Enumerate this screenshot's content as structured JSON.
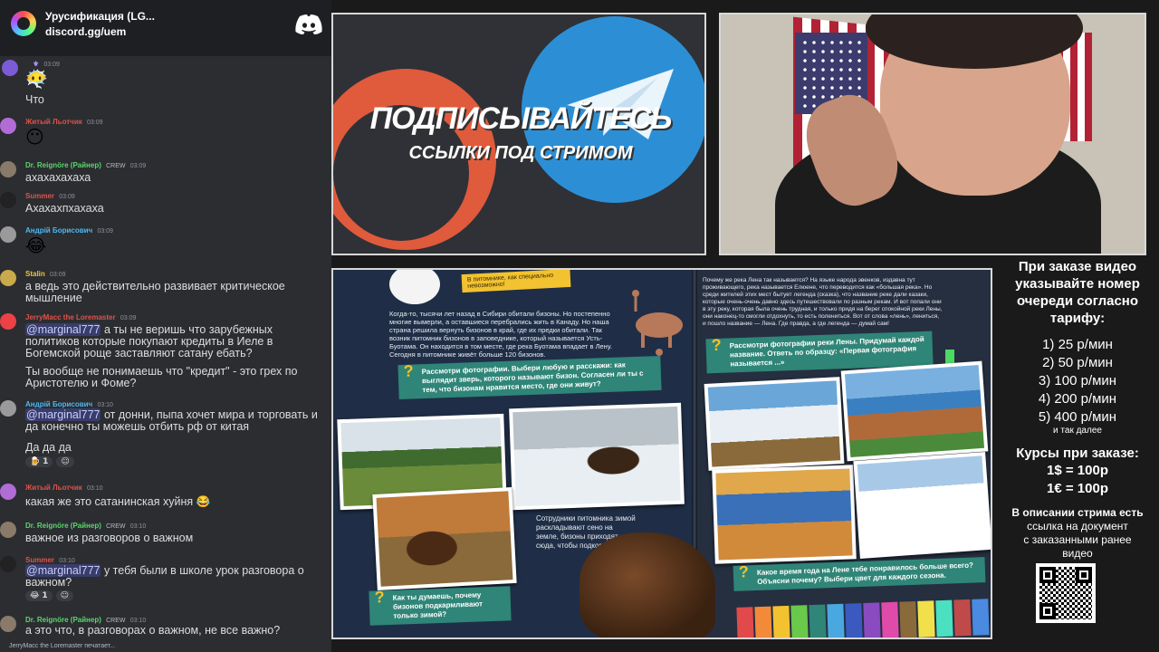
{
  "chat": {
    "server_name": "Урусификация (LG...",
    "server_link": "discord.gg/uem",
    "messages": [
      {
        "user": "",
        "time": "03:09",
        "emoji": "😶‍🌫️",
        "text": "Что",
        "color": "#c9c9c9"
      },
      {
        "user": "Житый Льотчик",
        "time": "03:09",
        "emoji": "😶",
        "text": "",
        "color": "#e0524a"
      },
      {
        "user": "Dr. Reignöre (Райнер)",
        "badge": "CREW",
        "time": "03:09",
        "text": "ахахахахаха",
        "color": "#5cd66c"
      },
      {
        "user": "Summer",
        "time": "03:09",
        "text": "Ахахахпхахаха",
        "color": "#e0524a"
      },
      {
        "user": "Андрій Борисович",
        "time": "03:09",
        "emoji": "😂",
        "text": "",
        "color": "#4fb7f0"
      },
      {
        "user": "Stalin",
        "time": "03:09",
        "text": "а ведь это действительно развивает критическое мышление",
        "color": "#f2c230"
      },
      {
        "user": "JerryMacc the Loremaster",
        "time": "03:09",
        "mention": "@marginal777",
        "text": " а ты не веришь что зарубежных политиков которые покупают кредиты в Иеле в Богемской роще заставляют сатану ебать?",
        "text2": "Ты вообще не понимаешь что \"кредит\" - это грех по Аристотелю и Фоме?",
        "color": "#e0524a"
      },
      {
        "user": "Андрій Борисович",
        "time": "03:10",
        "mention": "@марgiнал777",
        "text": " от донни, пыпа хочет мира и торговать и да конечно ты можешь отбить рф от китая",
        "text2": "Да да да",
        "color": "#4fb7f0"
      },
      {
        "user": "Житый Льотчик",
        "time": "03:10",
        "text": "какая же это сатанинская хуйня 😂",
        "color": "#e0524a"
      },
      {
        "user": "Dr. Reignöre (Райнер)",
        "badge": "CREW",
        "time": "03:10",
        "text": "важное из разговоров о важном",
        "color": "#5cd66c"
      },
      {
        "user": "Summer",
        "time": "03:10",
        "mention": "@marginal777",
        "text": " у тебя были в школе урок разговора о важном?",
        "color": "#e0524a"
      },
      {
        "user": "Dr. Reignöre (Райнер)",
        "badge": "CREW",
        "time": "03:10",
        "text": "а это что, в разговорах о важном, не все важно?",
        "color": "#5cd66c"
      }
    ],
    "reactions": {
      "r1": "1",
      "r2": "1"
    },
    "typing": "JerryMacc the Loremaster печатает..."
  },
  "promo": {
    "title": "ПОДПИСЫВАЙТЕСЬ",
    "subtitle": "ССЫЛКИ ПОД СТРИМОМ"
  },
  "book": {
    "yellow_note": "В питомнике, как специально\nневозможно!",
    "left_para": "Когда-то, тысячи лет назад в Сибири обитали бизоны. Но постепенно многие вымерли, а оставшиеся перебрались жить в Канаду. Но наша страна решила вернуть бизонов в край, где их предки обитали. Так возник питомник бизонов в заповеднике, который называется Усть-Буотама. Он находится в том месте, где река Буотама впадает в Лену. Сегодня в питомнике живёт больше 120 бизонов.",
    "left_task": "Рассмотри фотографии. Выбери любую и расскажи: как выглядит зверь, которого называют бизон. Согласен ли ты с тем, что бизонам нравится место, где они живут?",
    "left_caption": "Сотрудники питомника зимой раскладывают сено на земле, бизоны приходят сюда, чтобы подкормиться.",
    "left_question": "Как ты думаешь, почему бизонов подкармливают только зимой?",
    "right_para": "Почему же река Лена так называется? На языке народа эвенков, издавна тут проживающего, река называется Елюене, что переводится как «большая река». Но среди жителей этих мест бытует легенда (сказка), что название реке дали казаки, которые очень-очень давно здесь путешествовали по разным рекам. И вот попали они в эту реку, которая была очень трудная, и только придя на берег спокойной реки Лены, они наконец-то смогли отдохнуть, то есть полениться. Вот от слова «лень», лениться, и пошло название — Лена. Где правда, а где легенда — думай сам!",
    "right_task": "Рассмотри фотографии реки Лены. Придумай каждой название. Ответь по образцу: «Первая фотография называется ...»",
    "right_question": "Какое время года на Лене тебе понравилось больше всего? Объясни почему? Выбери цвет для каждого сезона."
  },
  "info": {
    "order_line1": "При заказе видео",
    "order_line2": "указывайте номер",
    "order_line3": "очереди согласно",
    "order_line4": "тарифу:",
    "tier1": "1) 25 р/мин",
    "tier2": "2) 50 р/мин",
    "tier3": "3) 100 р/мин",
    "tier4": "4) 200 р/мин",
    "tier5": "5) 400 р/мин",
    "etc": "и так далее",
    "rates_title": "Курсы при заказе:",
    "rate_usd": "1$ = 100р",
    "rate_eur": "1€ = 100р",
    "desc_line1": "В описании стрима есть",
    "desc_line2": "ссылка на документ",
    "desc_line3": "с заказанными ранее",
    "desc_line4": "видео"
  }
}
